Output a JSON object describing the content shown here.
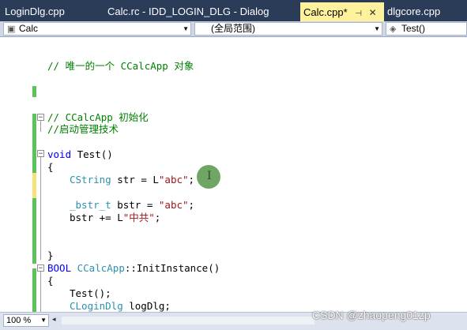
{
  "tabs": [
    {
      "label": "LoginDlg.cpp",
      "active": false
    },
    {
      "label": "Calc.rc - IDD_LOGIN_DLG - Dialog",
      "active": false
    },
    {
      "label": "Calc.cpp*",
      "active": true
    },
    {
      "label": "dlgcore.cpp",
      "active": false
    }
  ],
  "tab_icons": {
    "pin": "pin-icon",
    "close": "close-icon"
  },
  "navbar": {
    "project": "Calc",
    "scope": "(全局范围)",
    "member": "Test()",
    "member_icon": "method-icon"
  },
  "code_lines": {
    "l1": "// 唯一的一个 CCalcApp 对象",
    "l2_comment": "// CCalcApp 初始化",
    "l3_comment": "//启动管理技术",
    "l4_kw": "void",
    "l4_rest": " Test()",
    "l5": "{",
    "l6_type": "CString",
    "l6_mid": " str = L",
    "l6_str": "\"abc\"",
    "l6_end": ";",
    "l7_type": "_bstr_t",
    "l7_mid": " bstr = ",
    "l7_str": "\"abc\"",
    "l7_end": ";",
    "l8_mid": "bstr += L",
    "l8_str": "\"中共\"",
    "l8_end": ";",
    "l9": "}",
    "l10_kw": "BOOL",
    "l10_type": " CCalcApp",
    "l10_rest": "::InitInstance()",
    "l11": "{",
    "l12": "Test();",
    "l13_type": "CLoginDlg",
    "l13_rest": " logDlg;"
  },
  "status": {
    "zoom": "100 %"
  },
  "watermark": "CSDN @zhaopeng01zp",
  "colors": {
    "tab_bar": "#2b3c59",
    "active_tab": "#fff29d",
    "change_saved": "#5ec25b",
    "change_unsaved": "#f4e37a",
    "keyword": "#0000ff",
    "type": "#2b91af",
    "string": "#a31515",
    "comment": "#008000"
  }
}
